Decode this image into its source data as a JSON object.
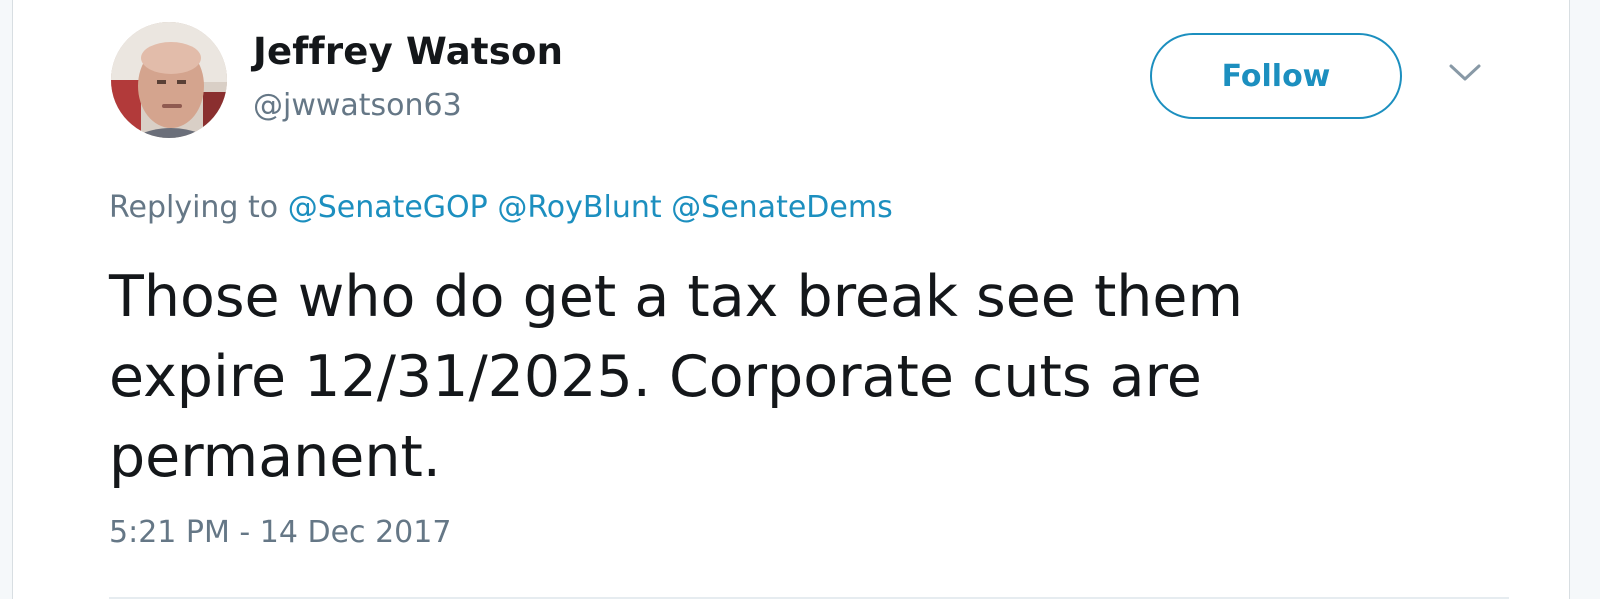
{
  "user": {
    "name": "Jeffrey Watson",
    "handle": "@jwwatson63"
  },
  "follow_button": {
    "label": "Follow"
  },
  "reply": {
    "prefix": "Replying to",
    "mentions": [
      "@SenateGOP",
      "@RoyBlunt",
      "@SenateDems"
    ]
  },
  "tweet": {
    "text": "Those who do get a tax break see them expire 12/31/2025. Corporate cuts are permanent.",
    "timestamp": "5:21 PM - 14 Dec 2017"
  },
  "icons": {
    "avatar": "profile-photo",
    "menu": "chevron-down-icon"
  },
  "colors": {
    "accent": "#1c8fbf",
    "text": "#14171a",
    "muted": "#657786",
    "background": "#ffffff"
  }
}
